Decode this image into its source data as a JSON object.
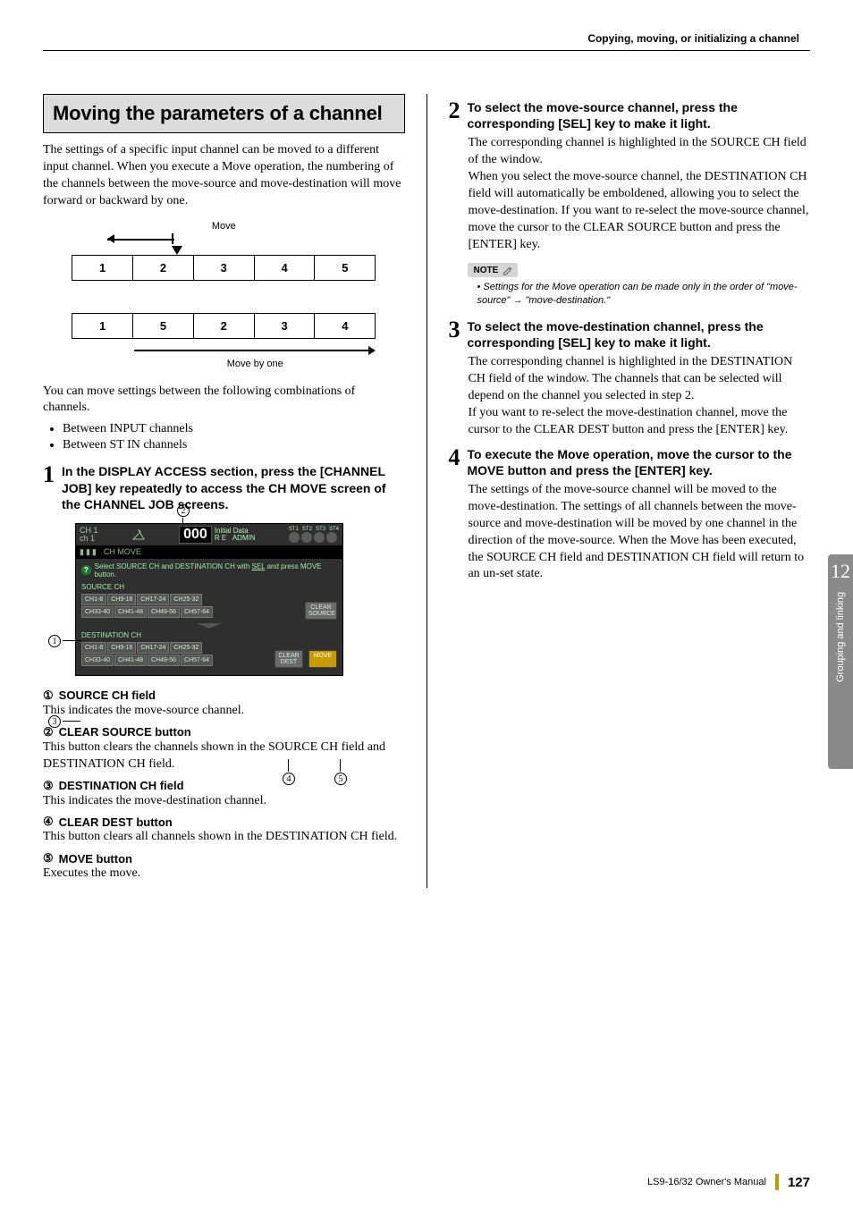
{
  "runningHead": "Copying, moving, or initializing a channel",
  "section": {
    "title": "Moving the parameters of a channel"
  },
  "intro1": "The settings of a specific input channel can be moved to a different input channel. When you execute a Move operation, the numbering of the channels between the move-source and move-destination will move forward or backward by one.",
  "diagram": {
    "moveLabel": "Move",
    "row1": [
      "1",
      "2",
      "3",
      "4",
      "5"
    ],
    "row2": [
      "1",
      "5",
      "2",
      "3",
      "4"
    ],
    "moveByOne": "Move by one"
  },
  "intro2": "You can move settings between the following combinations of channels.",
  "bullets": [
    "Between INPUT channels",
    "Between ST IN channels"
  ],
  "steps": {
    "s1": {
      "num": "1",
      "title": "In the DISPLAY ACCESS section, press the [CHANNEL JOB] key repeatedly to access the CH MOVE screen of the CHANNEL JOB screens."
    },
    "s2": {
      "num": "2",
      "title": "To select the move-source channel, press the corresponding [SEL] key to make it light.",
      "body": "The corresponding channel is highlighted in the SOURCE CH field of the window.\nWhen you select the move-source channel, the DESTINATION CH field will automatically be emboldened, allowing you to select the move-destination. If you want to re-select the move-source channel, move the cursor to the CLEAR SOURCE button and press the [ENTER] key."
    },
    "s3": {
      "num": "3",
      "title": "To select the move-destination channel, press the corresponding [SEL] key to make it light.",
      "body": "The corresponding channel is highlighted in the DESTINATION CH field of the window. The channels that can be selected will depend on the channel you selected in step 2.\nIf you want to re-select the move-destination channel, move the cursor to the CLEAR DEST button and press the [ENTER] key."
    },
    "s4": {
      "num": "4",
      "title": "To execute the Move operation, move the cursor to the MOVE button and press the [ENTER] key.",
      "body": "The settings of the move-source channel will be moved to the move-destination. The settings of all channels between the move-source and move-destination will be moved by one channel in the direction of the move-source. When the Move has been executed, the SOURCE CH field and DESTINATION CH field will return to an un-set state."
    }
  },
  "note": {
    "label": "NOTE",
    "text": "• Settings for the Move operation can be made only in the order of \"move-source\" → \"move-destination.\""
  },
  "ui": {
    "chLabel1": "CH 1",
    "chLabel2": "ch 1",
    "sceneNum": "000",
    "sceneText1": "Initial Data",
    "sceneText2": "R E",
    "admin": "ADMIN",
    "stLabels": [
      "ST1",
      "ST2",
      "ST3",
      "ST4"
    ],
    "tab": "CH MOVE",
    "hint": "Select SOURCE CH and DESTINATION CH with SEL and press MOVE button.",
    "sourceLabel": "SOURCE CH",
    "destLabel": "DESTINATION CH",
    "chBtns": [
      "CH1-8",
      "CH9-16",
      "CH17-24",
      "CH25-32",
      "CH33-40",
      "CH41-48",
      "CH49-56",
      "CH57-64"
    ],
    "clearSource": "CLEAR SOURCE",
    "clearDest": "CLEAR DEST",
    "move": "MOVE"
  },
  "defs": {
    "d1": {
      "num": "①",
      "title": "SOURCE CH field",
      "body": "This indicates the move-source channel."
    },
    "d2": {
      "num": "②",
      "title": "CLEAR SOURCE button",
      "body": "This button clears the channels shown in the SOURCE CH field and DESTINATION CH field."
    },
    "d3": {
      "num": "③",
      "title": "DESTINATION CH field",
      "body": "This indicates the move-destination channel."
    },
    "d4": {
      "num": "④",
      "title": "CLEAR DEST button",
      "body": "This button clears all channels shown in the DESTINATION CH field."
    },
    "d5": {
      "num": "⑤",
      "title": "MOVE button",
      "body": "Executes the move."
    }
  },
  "sideTab": {
    "chapterNum": "12",
    "text": "Grouping and linking"
  },
  "footer": {
    "manual": "LS9-16/32  Owner's Manual",
    "page": "127"
  }
}
